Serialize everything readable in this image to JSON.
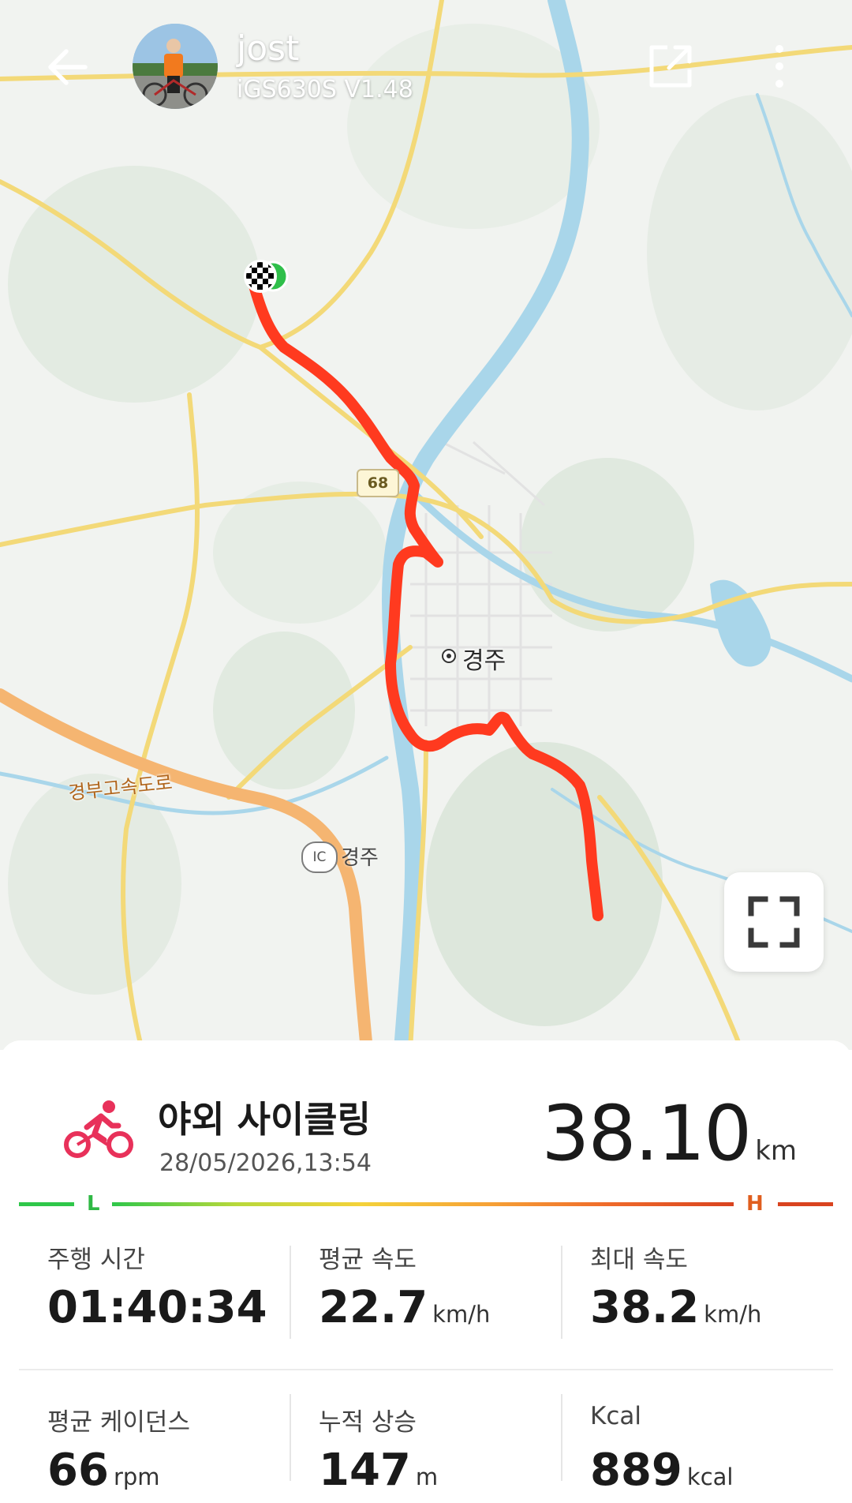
{
  "header": {
    "user_name": "jost",
    "device": "iGS630S  V1.48"
  },
  "map": {
    "road_number": "68",
    "city_label": "경주",
    "highway_label": "경부고속도로",
    "ic_badge": "IC",
    "ic_label": "경주"
  },
  "activity": {
    "title": "야외 사이클링",
    "datetime": "28/05/2026,13:54",
    "distance_value": "38.10",
    "distance_unit": "km",
    "accent_color": "#e8315a"
  },
  "intensity_scale": {
    "low_label": "L",
    "high_label": "H"
  },
  "stats": [
    {
      "label": "주행 시간",
      "value": "01:40:34",
      "unit": ""
    },
    {
      "label": "평균 속도",
      "value": "22.7",
      "unit": "km/h"
    },
    {
      "label": "최대 속도",
      "value": "38.2",
      "unit": "km/h"
    },
    {
      "label": "평균 케이던스",
      "value": "66",
      "unit": "rpm"
    },
    {
      "label": "누적 상승",
      "value": "147",
      "unit": "m"
    },
    {
      "label": "Kcal",
      "value": "889",
      "unit": "kcal"
    }
  ],
  "colors": {
    "route": "#ff3a1f",
    "river": "#a9d6ea",
    "main_road": "#f3d978",
    "highway": "#f5b571"
  }
}
